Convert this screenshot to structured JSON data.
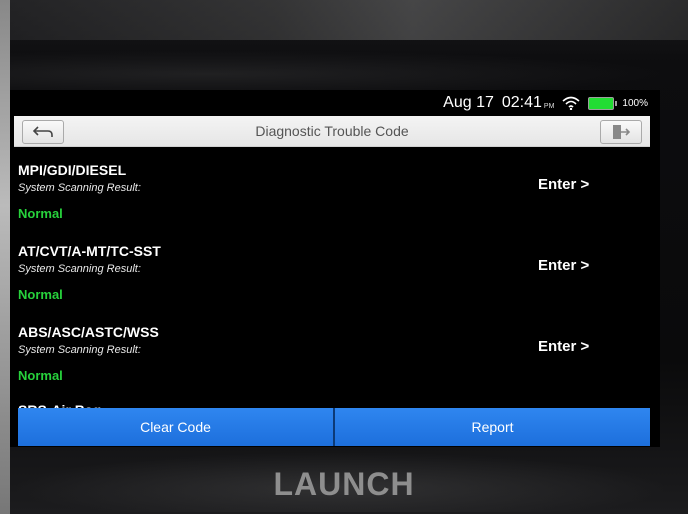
{
  "status_bar": {
    "date": "Aug 17",
    "time": "02:41",
    "ampm": "PM",
    "battery": "100%",
    "battery_color": "#22dd33"
  },
  "header": {
    "title": "Diagnostic Trouble Code",
    "back_icon": "back-arrow-icon",
    "exit_icon": "exit-icon"
  },
  "systems": [
    {
      "name": "MPI/GDI/DIESEL",
      "result_label": "System Scanning Result:",
      "status": "Normal",
      "action": "Enter >"
    },
    {
      "name": "AT/CVT/A-MT/TC-SST",
      "result_label": "System Scanning Result:",
      "status": "Normal",
      "action": "Enter >"
    },
    {
      "name": "ABS/ASC/ASTC/WSS",
      "result_label": "System Scanning Result:",
      "status": "Normal",
      "action": "Enter >"
    }
  ],
  "partial_item": "SRS-Air Bag",
  "actions": {
    "clear": "Clear Code",
    "report": "Report",
    "accent_color": "#1d6fdc"
  },
  "status_color": "#27d23c",
  "brand": "LAUNCH"
}
